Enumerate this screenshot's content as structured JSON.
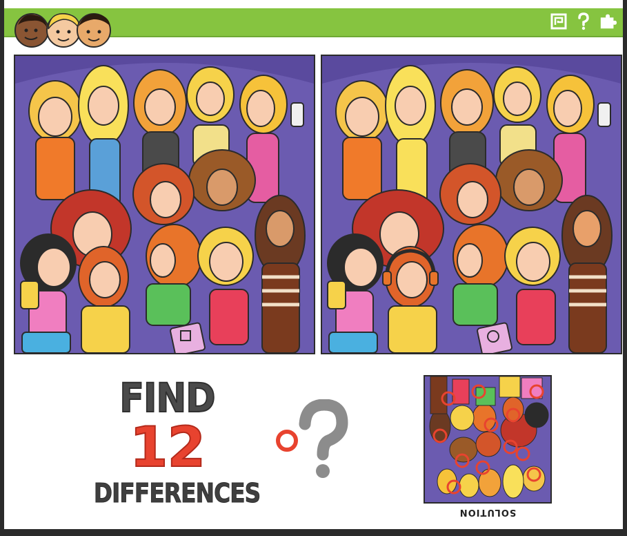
{
  "game": {
    "find_label": "FIND",
    "count_label": "12",
    "differences_label": "DIFFERENCES",
    "solution_label": "SOLUTION"
  },
  "header": {
    "icons": [
      "square-spiral-icon",
      "question-icon",
      "puzzle-piece-icon"
    ]
  },
  "colors": {
    "header_green": "#86c440",
    "background_purple": "#6b5bb0",
    "accent_red": "#e8432f",
    "text_gray": "#4a4a4a",
    "frame_dark": "#2b2b2b"
  }
}
